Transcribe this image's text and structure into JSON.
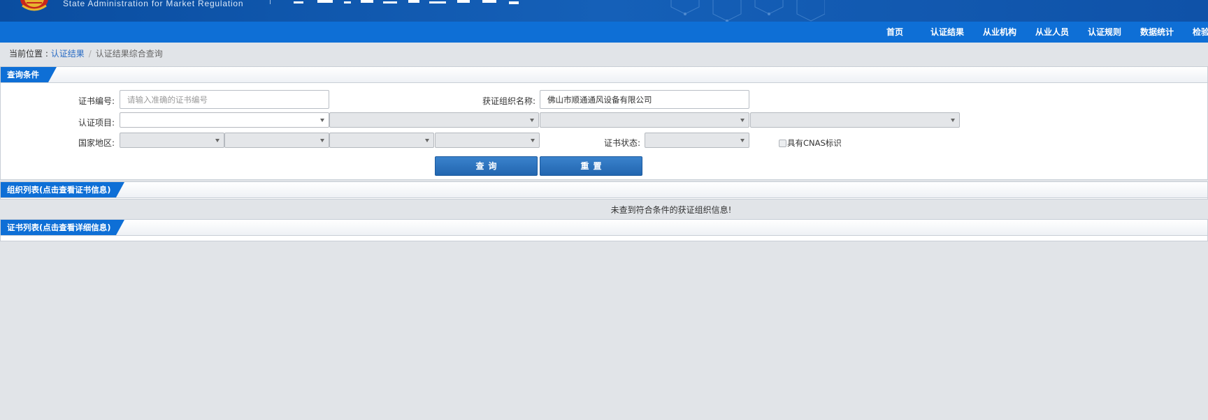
{
  "header": {
    "agency_en": "State Administration  for  Market Regulation"
  },
  "nav": {
    "items": [
      "首页",
      "认证结果",
      "从业机构",
      "从业人员",
      "认证规则",
      "数据统计",
      "检验"
    ]
  },
  "breadcrumb": {
    "prefix": "当前位置 : ",
    "link": "认证结果",
    "separator": "/",
    "current": "认证结果综合查询"
  },
  "query_panel": {
    "title": "查询条件",
    "cert_no_label": "证书编号:",
    "cert_no_placeholder": "请输入准确的证书编号",
    "cert_no_value": "",
    "org_name_label": "获证组织名称:",
    "org_name_value": "佛山市顺通通风设备有限公司",
    "project_label": "认证项目:",
    "region_label": "国家地区:",
    "status_label": "证书状态:",
    "cnas_label": "具有CNAS标识",
    "search_button": "查询",
    "reset_button": "重置"
  },
  "org_panel": {
    "title": "组织列表(点击查看证书信息)",
    "empty_message": "未查到符合条件的获证组织信息!"
  },
  "cert_panel": {
    "title": "证书列表(点击查看详细信息)"
  },
  "colors": {
    "banner": "#1560b8",
    "nav": "#0e6fd6",
    "button": "#2a72bf",
    "page_bg": "#e1e4e8"
  }
}
